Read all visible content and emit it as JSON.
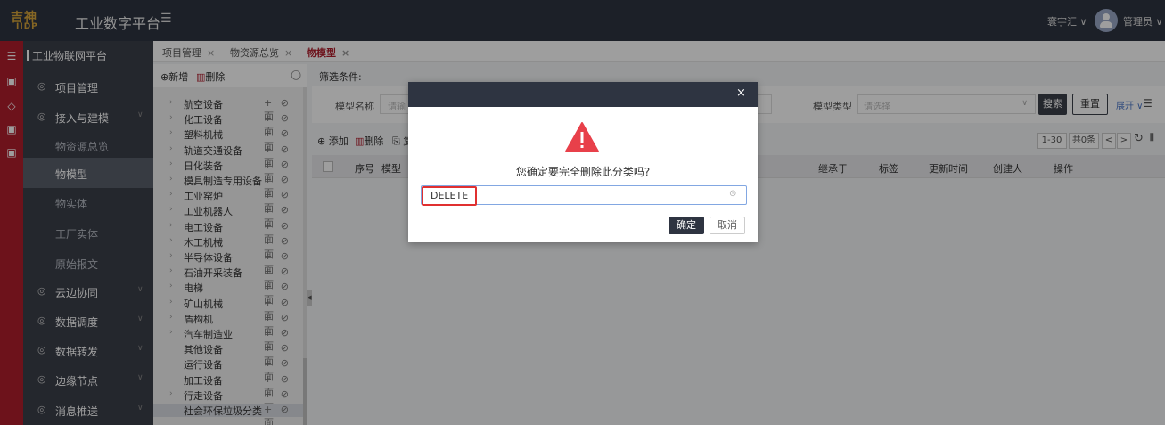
{
  "header": {
    "logo_top": "吉神",
    "logo_bottom": "IIDP",
    "title": "工业数字平台",
    "company": "寰宇汇 ∨",
    "user": "管理员 ∨"
  },
  "sidebar": {
    "platform": "工业物联网平台",
    "items": [
      {
        "label": "项目管理",
        "icon": "◎"
      },
      {
        "label": "接入与建模",
        "icon": "◎",
        "chevron": "∨"
      },
      {
        "label": "物资源总览"
      },
      {
        "label": "物模型"
      },
      {
        "label": "物实体"
      },
      {
        "label": "工厂实体"
      },
      {
        "label": "原始报文"
      },
      {
        "label": "云边协同",
        "icon": "◎",
        "chevron": "∨"
      },
      {
        "label": "数据调度",
        "icon": "◎",
        "chevron": "∨"
      },
      {
        "label": "数据转发",
        "icon": "◎",
        "chevron": "∨"
      },
      {
        "label": "边缘节点",
        "icon": "◎",
        "chevron": "∨"
      },
      {
        "label": "消息推送",
        "icon": "◎",
        "chevron": "∨"
      }
    ]
  },
  "tabs": [
    {
      "label": "项目管理",
      "close": "×"
    },
    {
      "label": "物资源总览",
      "close": "×"
    },
    {
      "label": "物模型",
      "close": "×"
    }
  ],
  "tree": {
    "add_label": "⊕新增",
    "delete_label": "删除",
    "nodes": [
      {
        "label": "航空设备"
      },
      {
        "label": "化工设备"
      },
      {
        "label": "塑料机械"
      },
      {
        "label": "轨道交通设备"
      },
      {
        "label": "日化装备"
      },
      {
        "label": "模具制造专用设备"
      },
      {
        "label": "工业窑炉"
      },
      {
        "label": "工业机器人"
      },
      {
        "label": "电工设备"
      },
      {
        "label": "木工机械"
      },
      {
        "label": "半导体设备"
      },
      {
        "label": "石油开采装备"
      },
      {
        "label": "电梯"
      },
      {
        "label": "矿山机械"
      },
      {
        "label": "盾构机"
      },
      {
        "label": "汽车制造业"
      },
      {
        "label": "其他设备"
      },
      {
        "label": "运行设备"
      },
      {
        "label": "加工设备"
      },
      {
        "label": "行走设备"
      },
      {
        "label": "社会环保垃圾分类"
      }
    ],
    "row_actions": "+ ⊘ 面"
  },
  "main": {
    "filter_label": "筛选条件:",
    "model_name_label": "模型名称",
    "model_name_placeholder": "请输",
    "model_type_label": "模型类型",
    "model_type_placeholder": "请选择",
    "search": "搜索",
    "reset": "重置",
    "expand": "展开 ∨",
    "add": "⊕ 添加",
    "delete": "删除",
    "copy": "⎘ 复",
    "pager_range": "1-30",
    "pager_total": "共0条",
    "pager_prev": "<",
    "pager_next": ">",
    "columns": [
      "序号",
      "模型",
      "继承于",
      "标签",
      "更新时间",
      "创建人",
      "操作"
    ]
  },
  "modal": {
    "close": "×",
    "message": "您确定要完全删除此分类吗?",
    "input_value": "DELETE",
    "confirm": "确定",
    "cancel": "取消"
  }
}
